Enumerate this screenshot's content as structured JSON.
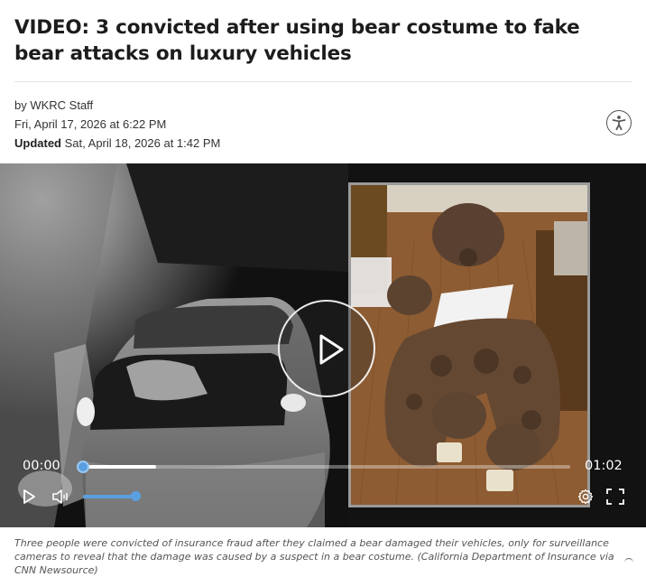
{
  "article": {
    "headline": "VIDEO: 3 convicted after using bear costume to fake bear attacks on luxury vehicles",
    "author": "by WKRC Staff",
    "published": "Fri, April 17, 2026 at 6:22 PM",
    "updated_label": "Updated",
    "updated": "Sat, April 18, 2026 at 1:42 PM",
    "caption": "Three people were convicted of insurance fraud after they claimed a bear damaged their vehicles, only for surveillance cameras to reveal that the damage was caused by a suspect in a bear costume. (California Department of Insurance via CNN Newsource)"
  },
  "video": {
    "current_time": "00:00",
    "duration": "01:02",
    "progress_fraction": 0.0,
    "buffered_fraction": 0.15,
    "volume_fraction": 1.0,
    "accent_color": "#5aa0e0"
  },
  "icons": {
    "accessibility": "accessibility-icon",
    "play": "play-icon",
    "volume": "volume-icon",
    "settings": "gear-icon",
    "fullscreen": "fullscreen-icon"
  }
}
